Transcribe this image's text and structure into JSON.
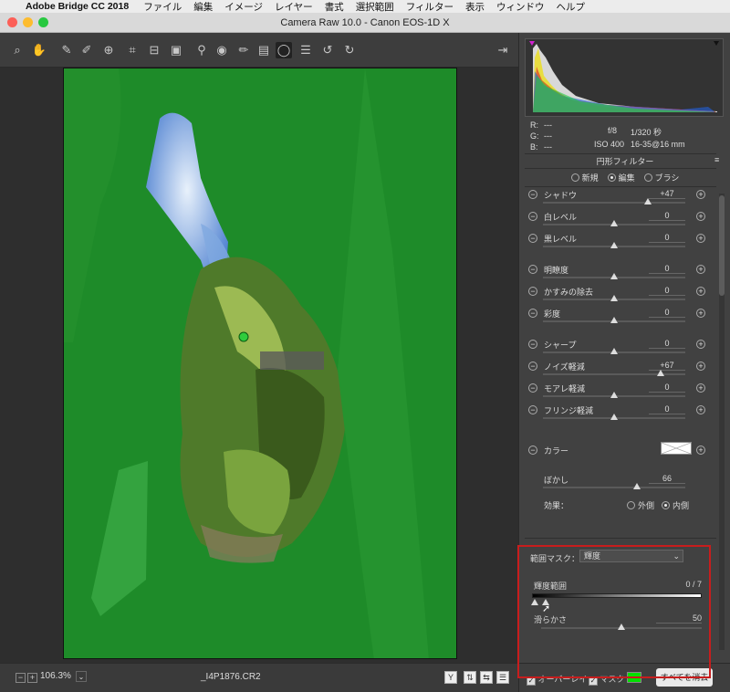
{
  "menubar": {
    "app_name": "Adobe Bridge CC 2018",
    "items": [
      "ファイル",
      "編集",
      "イメージ",
      "レイヤー",
      "書式",
      "選択範囲",
      "フィルター",
      "表示",
      "ウィンドウ",
      "ヘルプ"
    ]
  },
  "window": {
    "title": "Camera Raw 10.0  -  Canon EOS-1D X"
  },
  "toolbar": {
    "tools": [
      "zoom-icon",
      "hand-icon",
      "white-balance-icon",
      "color-sampler-icon",
      "targeted-adjustment-icon",
      "crop-icon",
      "straighten-icon",
      "transform-icon",
      "spot-removal-icon",
      "red-eye-icon",
      "adjustment-brush-icon",
      "graduated-filter-icon",
      "radial-filter-icon",
      "presets-icon",
      "rotate-left-icon",
      "rotate-right-icon"
    ]
  },
  "status": {
    "zoom": "106.3%",
    "filename": "_I4P1876.CR2"
  },
  "histogram": {
    "r_label": "R:",
    "g_label": "G:",
    "b_label": "B:",
    "r": "---",
    "g": "---",
    "b": "---",
    "aperture": "f/8",
    "shutter": "1/320 秒",
    "iso": "ISO 400",
    "lens": "16-35@16 mm"
  },
  "panel": {
    "title": "円形フィルター",
    "modes": [
      "新規",
      "編集",
      "ブラシ"
    ],
    "selected_mode": "編集"
  },
  "sliders": [
    {
      "label": "シャドウ",
      "value": "+47",
      "pos": 0.74
    },
    {
      "label": "白レベル",
      "value": "0",
      "pos": 0.5
    },
    {
      "label": "黒レベル",
      "value": "0",
      "pos": 0.5
    },
    {
      "label": "明瞭度",
      "value": "0",
      "pos": 0.5
    },
    {
      "label": "かすみの除去",
      "value": "0",
      "pos": 0.5
    },
    {
      "label": "彩度",
      "value": "0",
      "pos": 0.5
    },
    {
      "label": "シャープ",
      "value": "0",
      "pos": 0.5
    },
    {
      "label": "ノイズ軽減",
      "value": "+67",
      "pos": 0.83
    },
    {
      "label": "モアレ軽減",
      "value": "0",
      "pos": 0.5
    },
    {
      "label": "フリンジ軽減",
      "value": "0",
      "pos": 0.5
    }
  ],
  "color_label": "カラー",
  "feather": {
    "label": "ぼかし",
    "value": "66",
    "pos": 0.66
  },
  "effect": {
    "label": "効果：",
    "outside": "外側",
    "inside": "内側",
    "selected": "内側"
  },
  "range_mask": {
    "label": "範囲マスク：",
    "dropdown": "輝度",
    "luminance_range_label": "輝度範囲",
    "luminance_range_value": "0 / 7",
    "smoothness_label": "滑らかさ",
    "smoothness_value": "50",
    "smoothness_pos": 0.5
  },
  "bottom": {
    "overlay_label": "オーバーレイ",
    "mask_label": "マスク",
    "mask_color": "#00e000",
    "clear_all_label": "すべてを消去"
  }
}
